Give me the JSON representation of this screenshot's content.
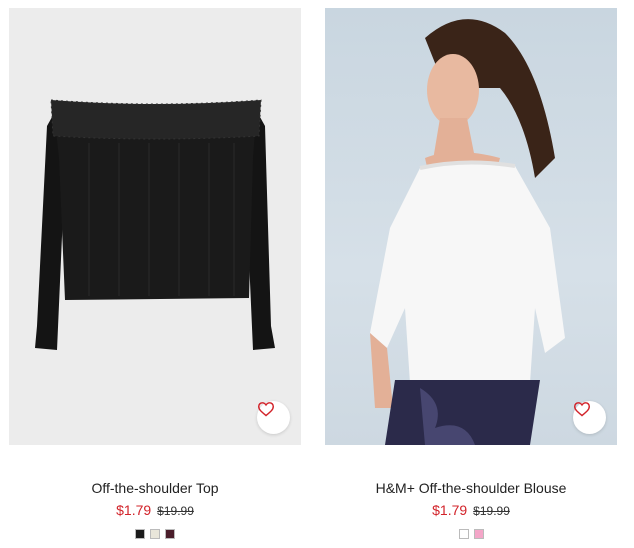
{
  "products": [
    {
      "name": "Off-the-shoulder Top",
      "sale_price": "$1.79",
      "original_price": "$19.99",
      "swatches": [
        "#1a1a1a",
        "#e9e6da",
        "#4a1d2a"
      ]
    },
    {
      "name": "H&M+ Off-the-shoulder Blouse",
      "sale_price": "$1.79",
      "original_price": "$19.99",
      "swatches": [
        "#ffffff",
        "#f4a6c8"
      ]
    }
  ],
  "icons": {
    "favorite": "heart-outline-icon"
  },
  "colors": {
    "sale": "#d2232a",
    "favorite": "#d2232a"
  }
}
